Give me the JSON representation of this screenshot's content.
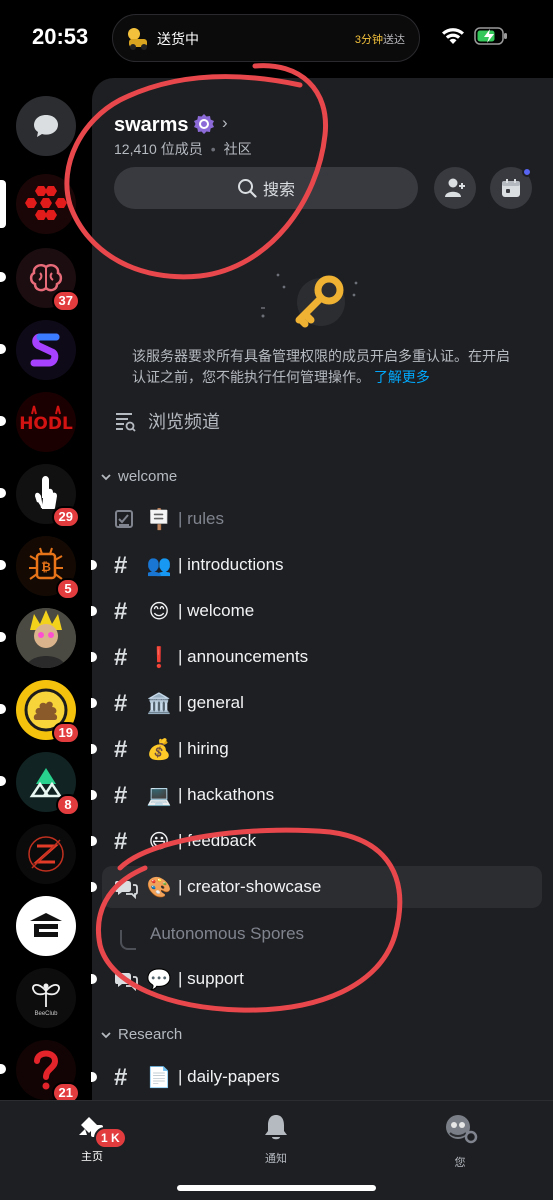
{
  "status_bar": {
    "time": "20:53",
    "activity_icon": "delivery-icon",
    "activity_text": "送货中",
    "activity_eta_value": "3分钟",
    "activity_eta_suffix": "送达"
  },
  "rail": {
    "dm_icon": "chat-bubble-icon",
    "servers": [
      {
        "icon": "red-hexagons-icon",
        "badge": ""
      },
      {
        "icon": "brain-icon",
        "badge": "37"
      },
      {
        "icon": "s-logo-icon",
        "badge": ""
      },
      {
        "icon": "hodl-icon",
        "badge": ""
      },
      {
        "icon": "hand-icon",
        "badge": "29"
      },
      {
        "icon": "bitcoin-bug-icon",
        "badge": "5"
      },
      {
        "icon": "avatar-photo-icon",
        "badge": ""
      },
      {
        "icon": "poop-coin-icon",
        "badge": "19"
      },
      {
        "icon": "triangle-logo-icon",
        "badge": "8"
      },
      {
        "icon": "z-logo-icon",
        "badge": ""
      },
      {
        "icon": "e-logo-icon",
        "badge": ""
      },
      {
        "icon": "beeclub-icon",
        "badge": "",
        "caption": "BeeClub"
      },
      {
        "icon": "question-mark-icon",
        "badge": "21"
      }
    ]
  },
  "server": {
    "name": "swarms",
    "member_count": "12,410 位成员",
    "type": "社区",
    "search_label": "搜索"
  },
  "notice": {
    "text": "该服务器要求所有具备管理权限的成员开启多重认证。在开启认证之前，您不能执行任何管理操作。",
    "link": "了解更多"
  },
  "browse_label": "浏览频道",
  "categories": [
    {
      "label": "welcome"
    },
    {
      "label": "Research"
    }
  ],
  "channels": [
    {
      "emoji": "🪧",
      "name": "| rules",
      "kind": "rules"
    },
    {
      "emoji": "👥",
      "name": "| introductions",
      "kind": "text"
    },
    {
      "emoji": "😊",
      "name": "| welcome",
      "kind": "text"
    },
    {
      "emoji": "❗",
      "name": "| announcements",
      "kind": "text"
    },
    {
      "emoji": "🏛️",
      "name": "| general",
      "kind": "text"
    },
    {
      "emoji": "💰",
      "name": "| hiring",
      "kind": "text"
    },
    {
      "emoji": "💻",
      "name": "| hackathons",
      "kind": "text"
    },
    {
      "emoji": "😃",
      "name": "| feedback",
      "kind": "text"
    },
    {
      "emoji": "🎨",
      "name": "| creator-showcase",
      "kind": "forum"
    },
    {
      "emoji": "💬",
      "name": "| support",
      "kind": "forum"
    },
    {
      "emoji": "📄",
      "name": "| daily-papers",
      "kind": "text"
    }
  ],
  "thread": {
    "name": "Autonomous Spores"
  },
  "bottom_nav": {
    "home_label": "主页",
    "home_badge": "1 K",
    "notifications_label": "通知",
    "you_label": "您"
  },
  "colors": {
    "annotation": "#e8484c",
    "badge": "#e23c3f",
    "link": "#00a8fc",
    "panel": "#1e1f22"
  }
}
